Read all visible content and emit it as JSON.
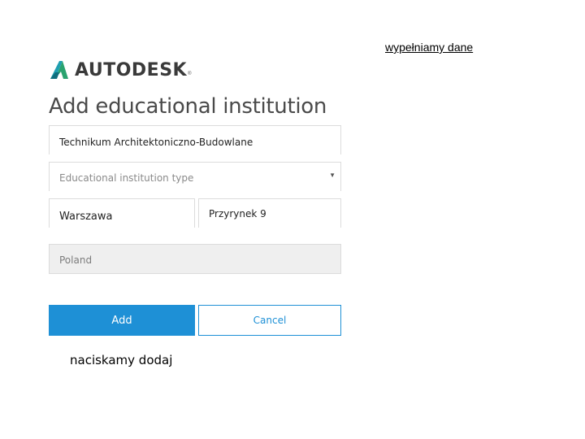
{
  "annotations": {
    "top_note": "wypełniamy dane",
    "bottom_note": "naciskamy dodaj"
  },
  "brand": {
    "logo_icon": "autodesk-logo-icon",
    "name": "AUTODESK",
    "registered_mark": "®"
  },
  "form": {
    "title": "Add educational institution",
    "institution_name": {
      "value": "Technikum Architektoniczno-Budowlane"
    },
    "institution_type": {
      "placeholder": "Educational institution type",
      "dropdown_icon": "caret-down-icon"
    },
    "city": {
      "value": "Warszawa"
    },
    "street": {
      "value": "Przyrynek 9"
    },
    "country": {
      "value": "Poland"
    },
    "add_label": "Add",
    "cancel_label": "Cancel"
  },
  "colors": {
    "accent": "#1e90d6",
    "field_border": "#dcdcdc",
    "disabled_bg": "#efefef"
  }
}
